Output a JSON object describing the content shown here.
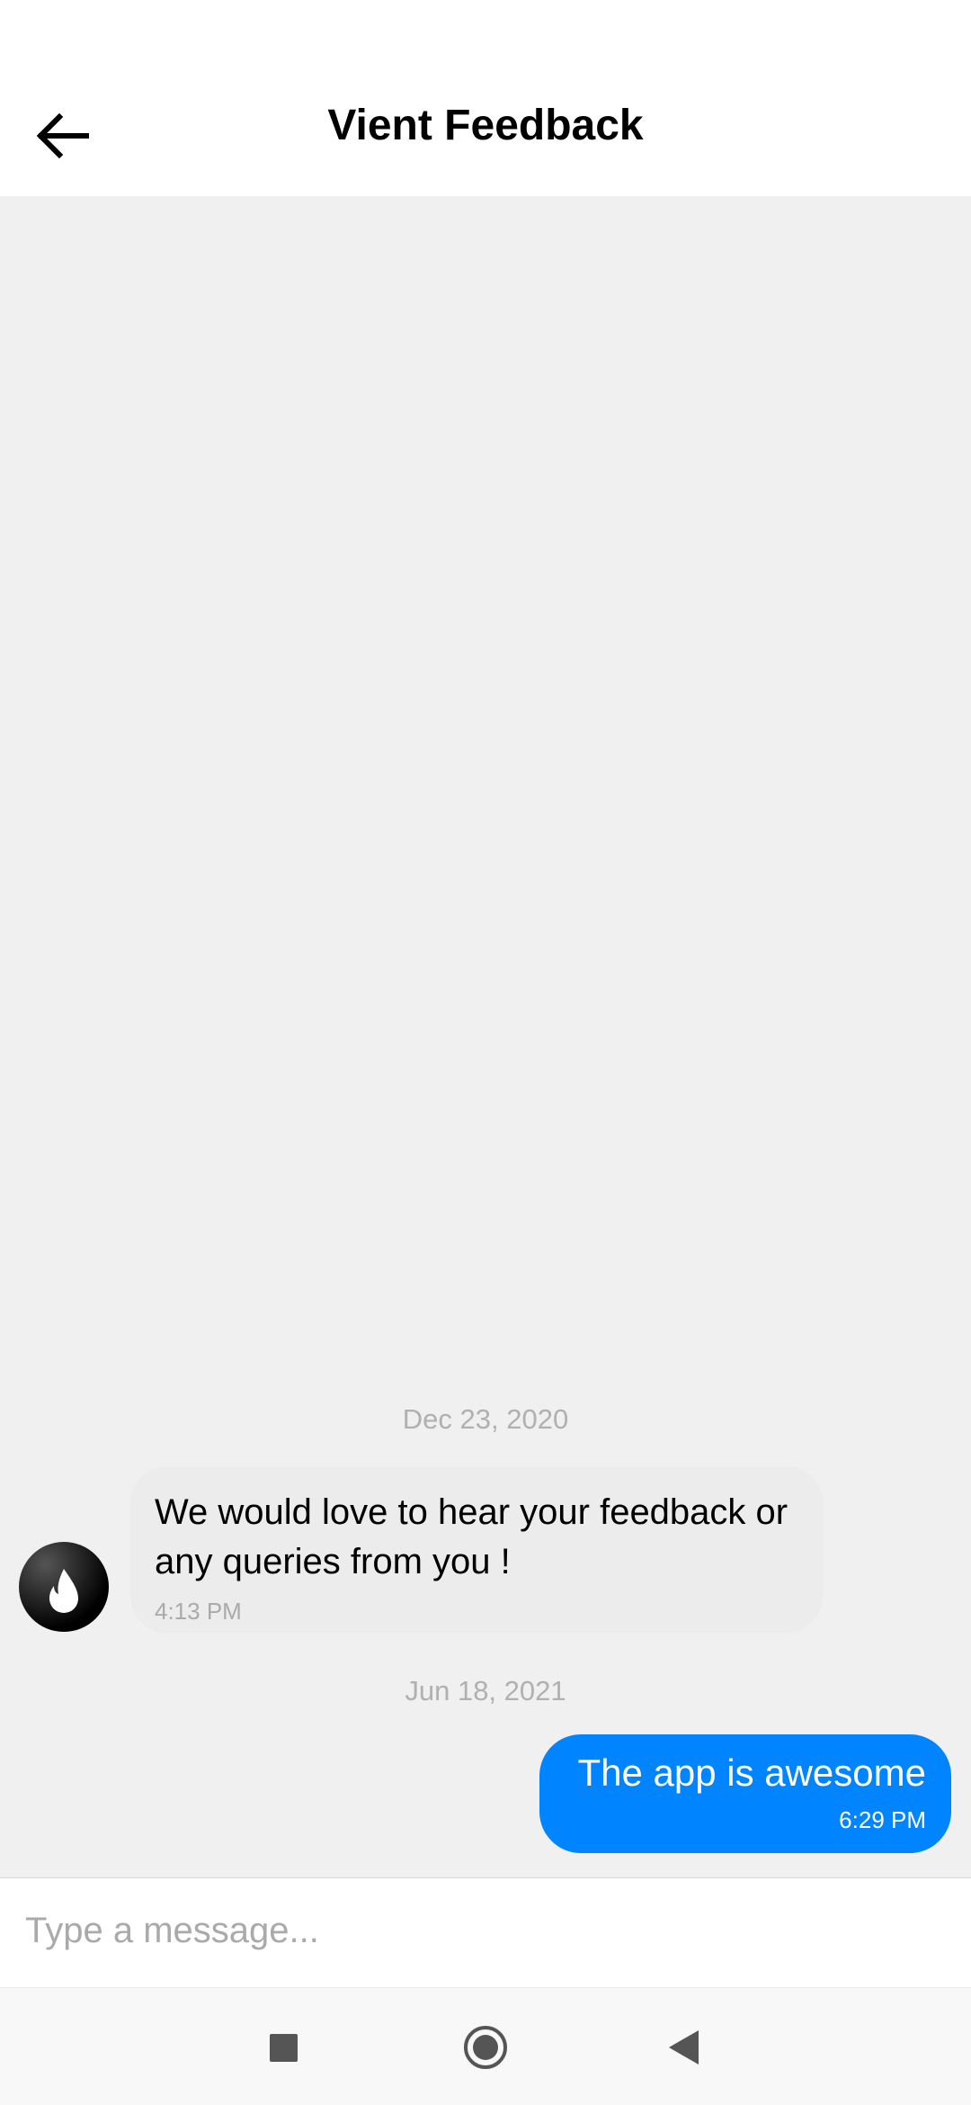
{
  "header": {
    "title": "Vient Feedback",
    "back_icon": "arrow-left-icon"
  },
  "messages": [
    {
      "date": "Dec 23, 2020",
      "direction": "incoming",
      "avatar_icon": "flame-icon",
      "text": "We would love to hear your feedback or any queries from you !",
      "time": "4:13 PM"
    },
    {
      "date": "Jun 18, 2021",
      "direction": "outgoing",
      "text": "The app is awesome",
      "time": "6:29 PM"
    }
  ],
  "composer": {
    "placeholder": "Type a message...",
    "value": ""
  },
  "nav": {
    "icons": [
      "recents-square-icon",
      "home-circle-icon",
      "back-triangle-icon"
    ]
  },
  "colors": {
    "outgoing_bubble": "#0084ff",
    "incoming_bubble": "#ececec",
    "chat_bg": "#f0f0f0"
  }
}
